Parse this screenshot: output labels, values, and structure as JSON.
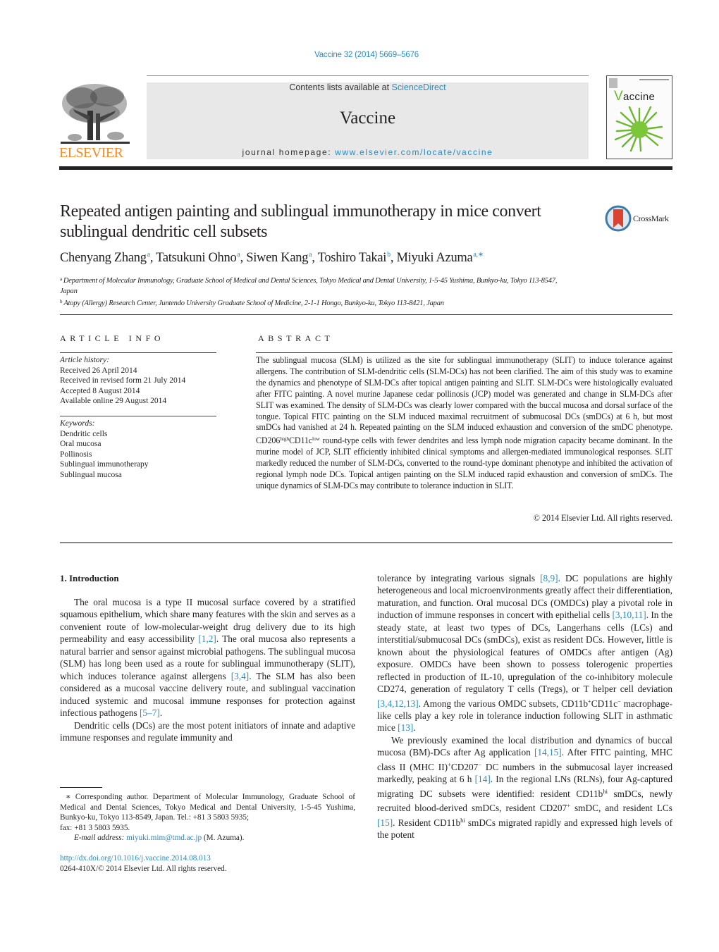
{
  "header": {
    "citation": "Vaccine 32 (2014) 5669–5676",
    "contents_prefix": "Contents lists available at ",
    "contents_link": "ScienceDirect",
    "journal_title": "Vaccine",
    "homepage_prefix": "journal homepage: ",
    "homepage_link": "www.elsevier.com/locate/vaccine",
    "publisher": "ELSEVIER",
    "cover_title_v": "V",
    "cover_title_rest": "accine",
    "brand_color": "#f28c28",
    "link_color": "#2a8bc1",
    "cover_accent": "#6ab82d"
  },
  "article": {
    "title": "Repeated antigen painting and sublingual immunotherapy in mice convert sublingual dendritic cell subsets",
    "crossmark_label": "CrossMark",
    "authors": [
      {
        "name": "Chenyang Zhang",
        "aff": "a",
        "sep": ", "
      },
      {
        "name": "Tatsukuni Ohno",
        "aff": "a",
        "sep": ", "
      },
      {
        "name": "Siwen Kang",
        "aff": "a",
        "sep": ", "
      },
      {
        "name": "Toshiro Takai",
        "aff": "b",
        "sep": ", "
      },
      {
        "name": "Miyuki Azuma",
        "aff": "a,∗",
        "sep": ""
      }
    ],
    "affiliations": [
      {
        "key": "a",
        "text": "Department of Molecular Immunology, Graduate School of Medical and Dental Sciences, Tokyo Medical and Dental University, 1-5-45 Yushima, Bunkyo-ku, Tokyo 113-8547, Japan"
      },
      {
        "key": "b",
        "text": "Atopy (Allergy) Research Center, Juntendo University Graduate School of Medicine, 2-1-1 Hongo, Bunkyo-ku, Tokyo 113-8421, Japan"
      }
    ]
  },
  "article_info": {
    "heading": "ARTICLE INFO",
    "history_label": "Article history:",
    "history": [
      "Received 26 April 2014",
      "Received in revised form 21 July 2014",
      "Accepted 8 August 2014",
      "Available online 29 August 2014"
    ],
    "keywords_label": "Keywords:",
    "keywords": [
      "Dendritic cells",
      "Oral mucosa",
      "Pollinosis",
      "Sublingual immunotherapy",
      "Sublingual mucosa"
    ]
  },
  "abstract": {
    "heading": "ABSTRACT",
    "part1": "The sublingual mucosa (SLM) is utilized as the site for sublingual immunotherapy (SLIT) to induce tolerance against allergens. The contribution of SLM-dendritic cells (SLM-DCs) has not been clarified. The aim of this study was to examine the dynamics and phenotype of SLM-DCs after topical antigen painting and SLIT. SLM-DCs were histologically evaluated after FITC painting. A novel murine Japanese cedar pollinosis (JCP) model was generated and change in SLM-DCs after SLIT was examined. The density of SLM-DCs was clearly lower compared with the buccal mucosa and dorsal surface of the tongue. Topical FITC painting on the SLM induced maximal recruitment of submucosal DCs (smDCs) at 6 h, but most smDCs had vanished at 24 h. Repeated painting on the SLM induced exhaustion and conversion of the smDC phenotype. CD206",
    "sup1": "high",
    "part2": "CD11c",
    "sup2": "low",
    "part3": " round-type cells with fewer dendrites and less lymph node migration capacity became dominant. In the murine model of JCP, SLIT efficiently inhibited clinical symptoms and allergen-mediated immunological responses. SLIT markedly reduced the number of SLM-DCs, converted to the round-type dominant phenotype and inhibited the activation of regional lymph node DCs. Topical antigen painting on the SLM induced rapid exhaustion and conversion of smDCs. The unique dynamics of SLM-DCs may contribute to tolerance induction in SLIT.",
    "copyright": "© 2014 Elsevier Ltd. All rights reserved."
  },
  "introduction": {
    "heading": "1.  Introduction",
    "left_p1": [
      {
        "t": "The oral mucosa is a type II mucosal surface covered by a stratified squamous epithelium, which share many features with the skin and serves as a convenient route of low-molecular-weight drug delivery due to its high permeability and easy accessibility "
      },
      {
        "ref": "[1,2]"
      },
      {
        "t": ". The oral mucosa also represents a natural barrier and sensor against microbial pathogens. The sublingual mucosa (SLM) has long been used as a route for sublingual immunotherapy (SLIT), which induces tolerance against allergens "
      },
      {
        "ref": "[3,4]"
      },
      {
        "t": ". The SLM has also been considered as a mucosal vaccine delivery route, and sublingual vaccination induced systemic and mucosal immune responses for protection against infectious pathogens "
      },
      {
        "ref": "[5–7]"
      },
      {
        "t": "."
      }
    ],
    "left_p2": "Dendritic cells (DCs) are the most potent initiators of innate and adaptive immune responses and regulate immunity and",
    "right_p1": [
      {
        "t": "tolerance by integrating various signals "
      },
      {
        "ref": "[8,9]"
      },
      {
        "t": ". DC populations are highly heterogeneous and local microenvironments greatly affect their differentiation, maturation, and function. Oral mucosal DCs (OMDCs) play a pivotal role in induction of immune responses in concert with epithelial cells "
      },
      {
        "ref": "[3,10,11]"
      },
      {
        "t": ". In the steady state, at least two types of DCs, Langerhans cells (LCs) and interstitial/submucosal DCs (smDCs), exist as resident DCs. However, little is known about the physiological features of OMDCs after antigen (Ag) exposure. OMDCs have been shown to possess tolerogenic properties reflected in production of IL-10, upregulation of the co-inhibitory molecule CD274, generation of regulatory T cells (Tregs), or T helper cell deviation "
      },
      {
        "ref": "[3,4,12,13]"
      },
      {
        "t": ". Among the various OMDC subsets, CD11b"
      },
      {
        "sup": "+"
      },
      {
        "t": "CD11c"
      },
      {
        "sup": "−"
      },
      {
        "t": " macrophage-like cells play a key role in tolerance induction following SLIT in asthmatic mice "
      },
      {
        "ref": "[13]"
      },
      {
        "t": "."
      }
    ],
    "right_p2": [
      {
        "t": "We previously examined the local distribution and dynamics of buccal mucosa (BM)-DCs after Ag application "
      },
      {
        "ref": "[14,15]"
      },
      {
        "t": ". After FITC painting, MHC class II (MHC II)"
      },
      {
        "sup": "+"
      },
      {
        "t": "CD207"
      },
      {
        "sup": "−"
      },
      {
        "t": " DC numbers in the submucosal layer increased markedly, peaking at 6 h "
      },
      {
        "ref": "[14]"
      },
      {
        "t": ". In the regional LNs (RLNs), four Ag-captured migrating DC subsets were identified: resident CD11b"
      },
      {
        "sup": "hi"
      },
      {
        "t": " smDCs, newly recruited blood-derived smDCs, resident CD207"
      },
      {
        "sup": "+"
      },
      {
        "t": " smDC, and resident LCs "
      },
      {
        "ref": "[15]"
      },
      {
        "t": ". Resident CD11b"
      },
      {
        "sup": "hi"
      },
      {
        "t": " smDCs migrated rapidly and expressed high levels of the potent"
      }
    ]
  },
  "footnote": {
    "corresponding": "∗  Corresponding author. Department of Molecular Immunology, Graduate School of Medical and Dental Sciences, Tokyo Medical and Dental University, 1-5-45 Yushima, Bunkyo-ku, Tokyo 113-8549, Japan. Tel.: +81 3 5803 5935;",
    "fax": "fax: +81 3 5803 5935.",
    "email_label": "E-mail address: ",
    "email": "miyuki.mim@tmd.ac.jp",
    "email_suffix": " (M. Azuma).",
    "doi": "http://dx.doi.org/10.1016/j.vaccine.2014.08.013",
    "issn": "0264-410X/© 2014 Elsevier Ltd. All rights reserved."
  }
}
